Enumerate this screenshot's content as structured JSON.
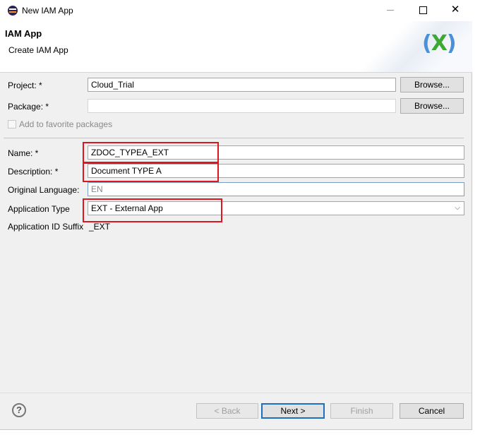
{
  "window": {
    "title": "New IAM App",
    "controls": {
      "minimize": "—",
      "maximize": "",
      "close": "✕"
    }
  },
  "header": {
    "title": "IAM App",
    "subtitle": "Create IAM App",
    "logo_left": "(",
    "logo_mid": "X",
    "logo_right": ")"
  },
  "form": {
    "project": {
      "label": "Project: *",
      "value": "Cloud_Trial",
      "browse": "Browse..."
    },
    "package": {
      "label": "Package: *",
      "value": "",
      "browse": "Browse..."
    },
    "favorite": {
      "label": "Add to favorite packages",
      "checked": false
    },
    "name": {
      "label": "Name: *",
      "value": "ZDOC_TYPEA_EXT"
    },
    "description": {
      "label": "Description: *",
      "value": "Document TYPE A"
    },
    "original_language": {
      "label": "Original Language:",
      "value": "EN"
    },
    "application_type": {
      "label": "Application Type",
      "value": "EXT - External App"
    },
    "application_id_suffix": {
      "label": "Application ID Suffix",
      "value": "_EXT"
    }
  },
  "footer": {
    "back": "< Back",
    "next": "Next >",
    "finish": "Finish",
    "cancel": "Cancel",
    "help": "?"
  },
  "colors": {
    "highlight": "#e0151f",
    "default_button_border": "#1f6fc1"
  }
}
